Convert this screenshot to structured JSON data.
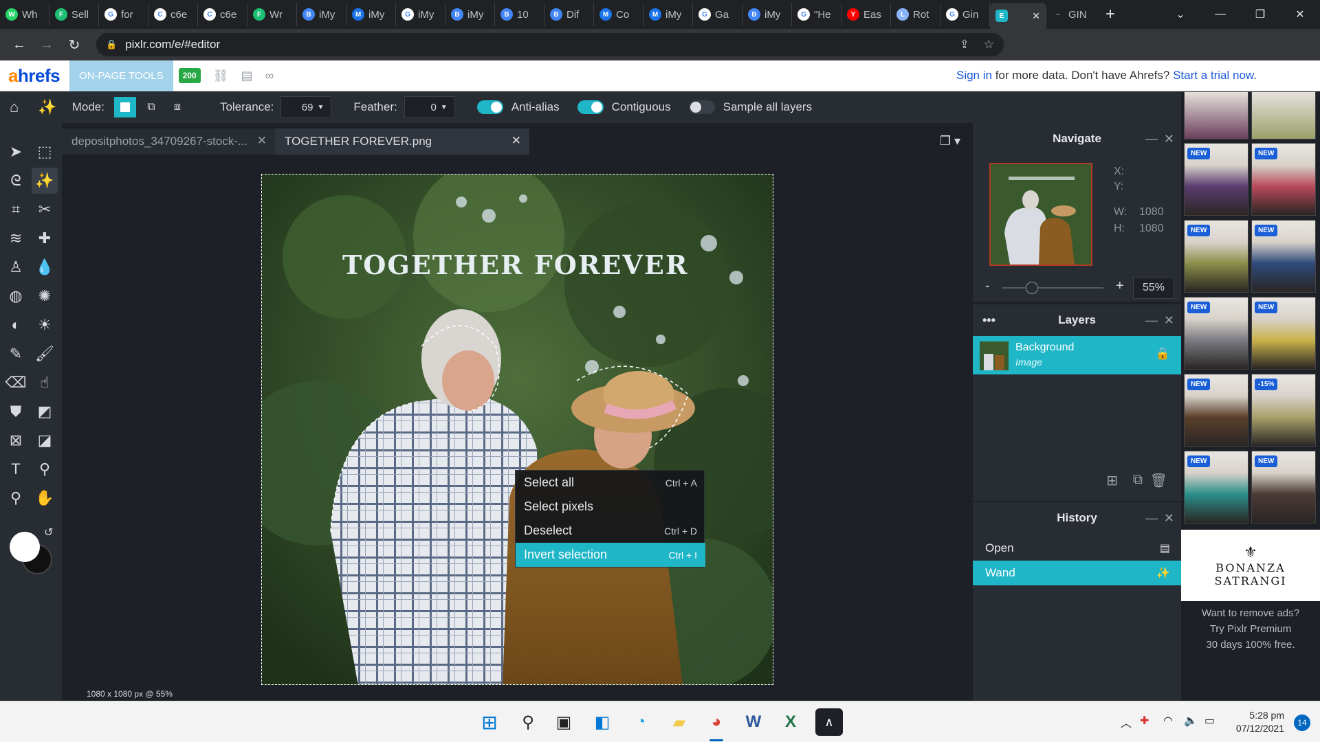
{
  "browser": {
    "tabs": [
      {
        "label": "Wh",
        "icon": "whatsapp-icon",
        "color": "#25d366"
      },
      {
        "label": "Sell",
        "icon": "fiverr-icon",
        "color": "#1dbf73"
      },
      {
        "label": "for",
        "icon": "google-icon",
        "color": "#ffffff"
      },
      {
        "label": "c6e",
        "icon": "chatgpt-icon",
        "color": "#ffffff"
      },
      {
        "label": "c6e",
        "icon": "chatgpt-icon",
        "color": "#ffffff"
      },
      {
        "label": "Wr",
        "icon": "fiverr-icon",
        "color": "#1dbf73"
      },
      {
        "label": "iMy",
        "icon": "bing-icon",
        "color": "#4285f4"
      },
      {
        "label": "iMy",
        "icon": "malwarebytes-icon",
        "color": "#1a73e8"
      },
      {
        "label": "iMy",
        "icon": "google-icon",
        "color": "#ffffff"
      },
      {
        "label": "iMy",
        "icon": "bing-icon",
        "color": "#4285f4"
      },
      {
        "label": "10",
        "icon": "bing-icon",
        "color": "#4285f4"
      },
      {
        "label": "Dif",
        "icon": "bing-icon",
        "color": "#4285f4"
      },
      {
        "label": "Co",
        "icon": "malwarebytes-icon",
        "color": "#1a73e8"
      },
      {
        "label": "iMy",
        "icon": "malwarebytes-icon",
        "color": "#1a73e8"
      },
      {
        "label": "Ga",
        "icon": "google-icon",
        "color": "#ffffff"
      },
      {
        "label": "iMy",
        "icon": "bing-icon",
        "color": "#4285f4"
      },
      {
        "label": "\"He",
        "icon": "google-icon",
        "color": "#ffffff"
      },
      {
        "label": "Eas",
        "icon": "youtube-icon",
        "color": "#ff0000"
      },
      {
        "label": "Rot",
        "icon": "loading-icon",
        "color": "#8ab4f8"
      },
      {
        "label": "Gin",
        "icon": "google-icon",
        "color": "#ffffff"
      }
    ],
    "active_tab": {
      "icon": "pixlr-icon",
      "close": "✕"
    },
    "trailing_tab": {
      "label": "GIN",
      "icon": "gin-icon"
    },
    "new_tab": "+",
    "url": "pixlr.com/e/#editor"
  },
  "ahrefs": {
    "logo_a": "a",
    "logo_rest": "hrefs",
    "on_page": "ON-PAGE TOOLS",
    "badge": "200",
    "sign_in": "Sign in",
    "msg_mid": " for more data. Don't have Ahrefs? ",
    "trial": "Start a trial now",
    "msg_end": "."
  },
  "toolbar": {
    "mode_label": "Mode:",
    "tolerance_label": "Tolerance:",
    "tolerance_value": "69",
    "feather_label": "Feather:",
    "feather_value": "0",
    "anti_alias": "Anti-alias",
    "contiguous": "Contiguous",
    "sample_all": "Sample all layers"
  },
  "documents": [
    {
      "name": "depositphotos_34709267-stock-...",
      "close": "✕"
    },
    {
      "name": "TOGETHER FOREVER.png",
      "close": "✕"
    }
  ],
  "canvas": {
    "overlay_text": "TOGETHER FOREVER",
    "status": "1080 x 1080 px @ 55%"
  },
  "context_menu": [
    {
      "label": "Select all",
      "shortcut": "Ctrl + A"
    },
    {
      "label": "Select pixels",
      "shortcut": ""
    },
    {
      "label": "Deselect",
      "shortcut": "Ctrl + D"
    },
    {
      "label": "Invert selection",
      "shortcut": "Ctrl + I"
    }
  ],
  "navigate": {
    "title": "Navigate",
    "x_label": "X:",
    "y_label": "Y:",
    "w_label": "W:",
    "w_value": "1080",
    "h_label": "H:",
    "h_value": "1080",
    "zoom": "55%",
    "zoom_level": 0.55
  },
  "layers": {
    "title": "Layers",
    "items": [
      {
        "name": "Background",
        "type": "Image"
      }
    ]
  },
  "history": {
    "title": "History",
    "items": [
      "Open",
      "Wand"
    ]
  },
  "ad": {
    "badges": [
      "NEW",
      "NEW",
      "NEW",
      "NEW",
      "NEW",
      "NEW",
      "NEW",
      "-15%",
      "NEW",
      "NEW"
    ],
    "brand_line1": "BONANZA",
    "brand_line2": "SATRANGI",
    "promo": [
      "Want to remove ads?",
      "Try Pixlr Premium",
      "30 days 100% free."
    ]
  },
  "taskbar": {
    "time": "5:28 pm",
    "date": "07/12/2021",
    "notifications": "14"
  },
  "colors": {
    "accent": "#1fb6c7",
    "panel": "#282c33",
    "workspace": "#1d2127"
  }
}
